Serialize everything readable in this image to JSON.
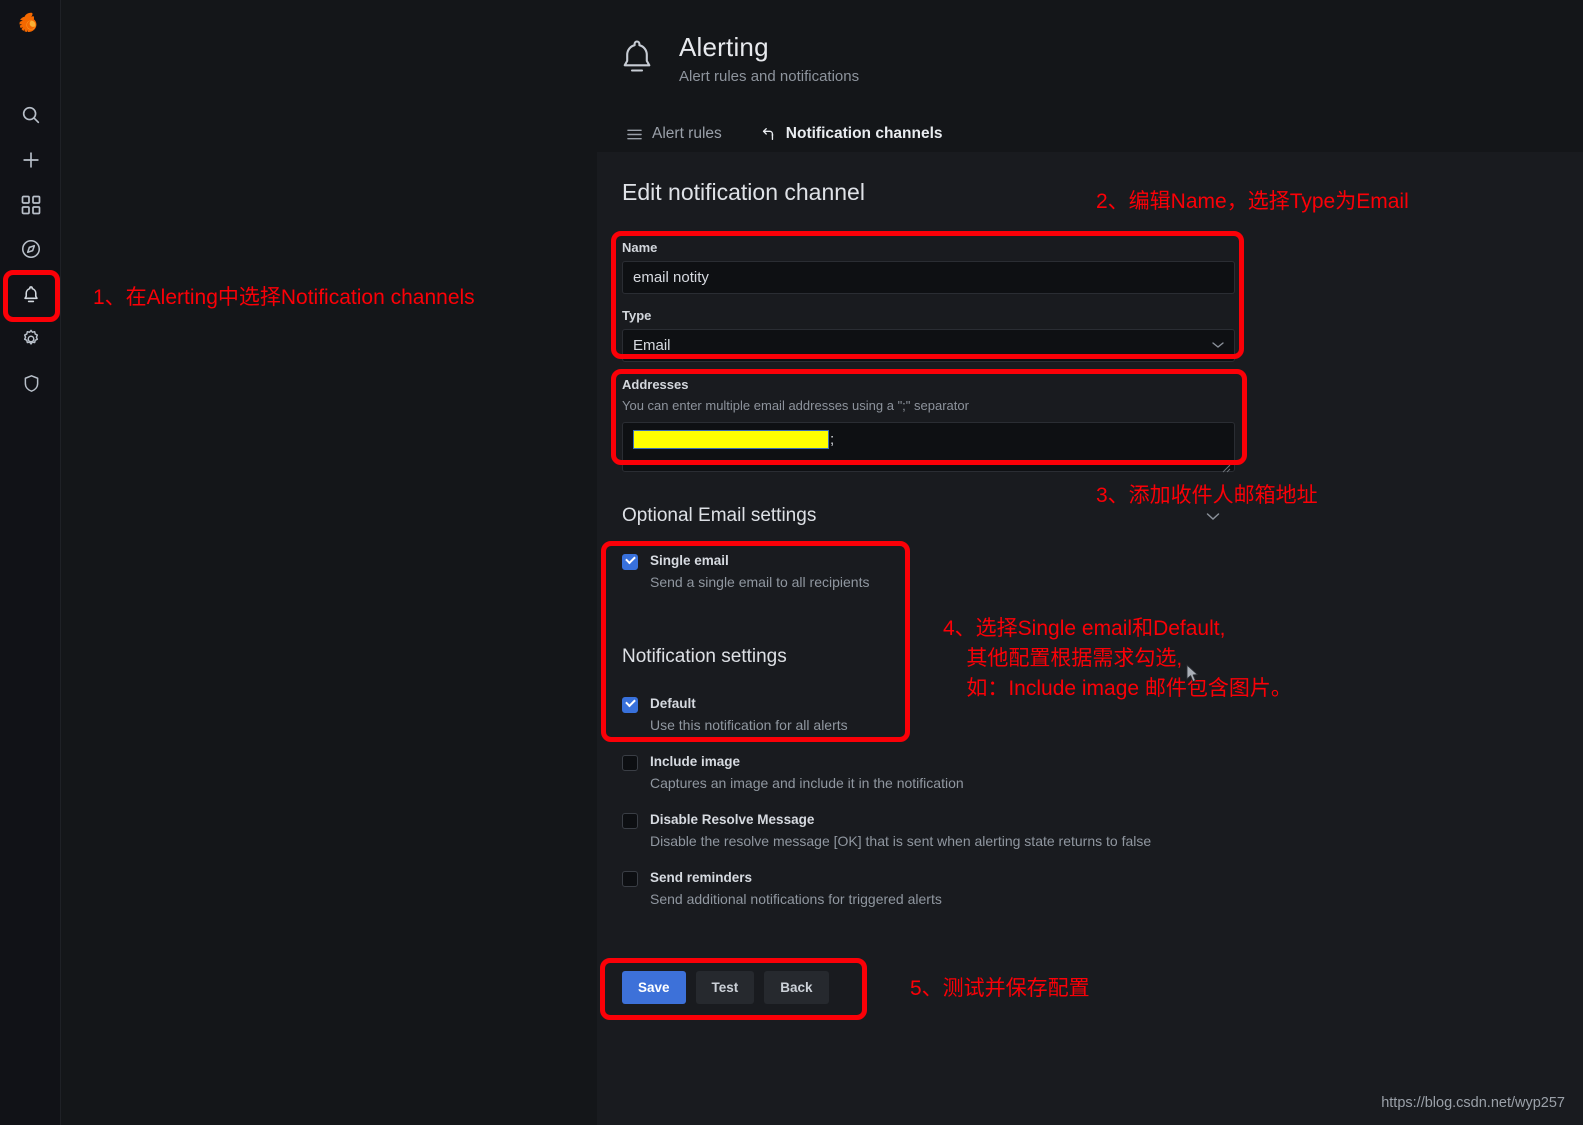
{
  "app": {
    "logo": "grafana-logo",
    "background": "#141619",
    "panel_background": "#191b1f",
    "accent": "#f2642a",
    "annotation_color": "#fb0007"
  },
  "sidebar": {
    "items": [
      {
        "icon": "search-icon",
        "name": "search"
      },
      {
        "icon": "plus-icon",
        "name": "create"
      },
      {
        "icon": "dashboards-grid-icon",
        "name": "dashboards"
      },
      {
        "icon": "compass-explore-icon",
        "name": "explore"
      },
      {
        "icon": "bell-alerting-icon",
        "name": "alerting",
        "active": true
      },
      {
        "icon": "gear-configuration-icon",
        "name": "configuration"
      },
      {
        "icon": "shield-admin-icon",
        "name": "server-admin"
      }
    ]
  },
  "header": {
    "icon": "bell-icon",
    "title": "Alerting",
    "subtitle": "Alert rules and notifications"
  },
  "tabs": [
    {
      "label": "Alert rules",
      "icon": "list-icon",
      "active": false
    },
    {
      "label": "Notification channels",
      "icon": "share-arrow-icon",
      "active": true
    }
  ],
  "form": {
    "title": "Edit notification channel",
    "name": {
      "label": "Name",
      "value": "email notity"
    },
    "type": {
      "label": "Type",
      "value": "Email",
      "chevron": "chevron-down-icon"
    },
    "addresses": {
      "label": "Addresses",
      "help": "You can enter multiple email addresses using a \";\" separator",
      "value_redacted": true,
      "value_suffix": ";"
    },
    "optional_section": "Optional Email settings",
    "notification_section": "Notification settings",
    "checkboxes": [
      {
        "label": "Single email",
        "desc": "Send a single email to all recipients",
        "checked": true,
        "group": "optional"
      },
      {
        "label": "Default",
        "desc": "Use this notification for all alerts",
        "checked": true,
        "group": "notification"
      },
      {
        "label": "Include image",
        "desc": "Captures an image and include it in the notification",
        "checked": false,
        "group": "notification"
      },
      {
        "label": "Disable Resolve Message",
        "desc": "Disable the resolve message [OK] that is sent when alerting state returns to false",
        "checked": false,
        "group": "notification"
      },
      {
        "label": "Send reminders",
        "desc": "Send additional notifications for triggered alerts",
        "checked": false,
        "group": "notification"
      }
    ],
    "buttons": [
      {
        "label": "Save",
        "style": "primary"
      },
      {
        "label": "Test",
        "style": "secondary"
      },
      {
        "label": "Back",
        "style": "secondary"
      }
    ]
  },
  "annotations": [
    {
      "id": 1,
      "text": "1、在Alerting中选择Notification channels"
    },
    {
      "id": 2,
      "text": "2、编辑Name，选择Type为Email"
    },
    {
      "id": 3,
      "text": "3、添加收件人邮箱地址"
    },
    {
      "id": 4,
      "text": "4、选择Single email和Default,\n    其他配置根据需求勾选,\n    如：Include image 邮件包含图片。"
    },
    {
      "id": 5,
      "text": "5、测试并保存配置"
    }
  ],
  "watermark": "https://blog.csdn.net/wyp257"
}
